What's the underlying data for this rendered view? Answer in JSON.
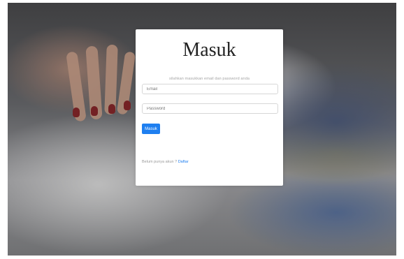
{
  "login": {
    "title": "Masuk",
    "subtitle": "silahkan masukkan email dan password anda",
    "email_placeholder": "Email",
    "password_placeholder": "Password",
    "submit_label": "Masuk",
    "signup_prompt": "Belum punya akun ?",
    "signup_link": "Daftar"
  },
  "colors": {
    "accent": "#1e7ff0",
    "card_background": "#ffffff"
  }
}
